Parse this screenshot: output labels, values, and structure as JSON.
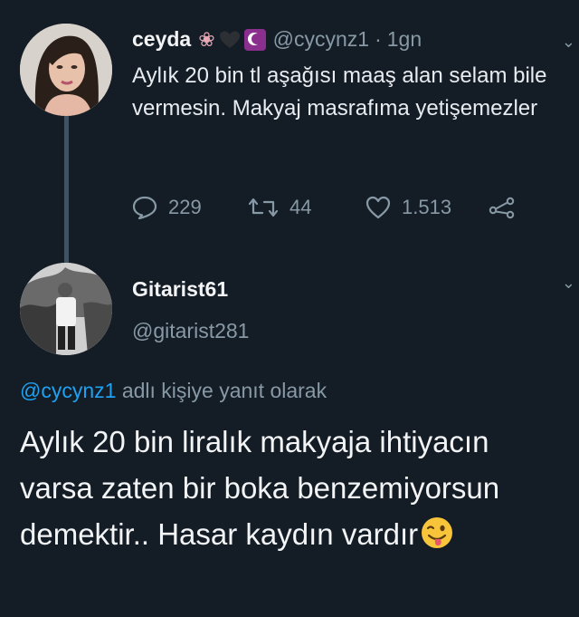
{
  "tweet1": {
    "name": "ceyda",
    "emoji_flower": "❀",
    "handle": "@cycynz1",
    "separator": "·",
    "time": "1gn",
    "text": "Aylık 20 bin tl aşağısı maaş alan selam bile vermesin. Makyaj masrafıma yetişemezler",
    "actions": {
      "reply_count": "229",
      "retweet_count": "44",
      "like_count": "1.513"
    }
  },
  "tweet2": {
    "name": "Gitarist61",
    "handle": "@gitarist281",
    "reply_mention": "@cycynz1",
    "reply_suffix": " adlı kişiye yanıt olarak",
    "text": "Aylık 20 bin liralık makyaja ihtiyacın varsa zaten bir boka benzemiyorsun demektir.. Hasar kaydın vardır"
  },
  "icons": {
    "chevron": "⌄",
    "wink_emoji": "winking-tongue-face"
  },
  "colors": {
    "background": "#141d26",
    "muted": "#8899a6",
    "link": "#1da1f2",
    "thread_line": "#3d5466"
  }
}
